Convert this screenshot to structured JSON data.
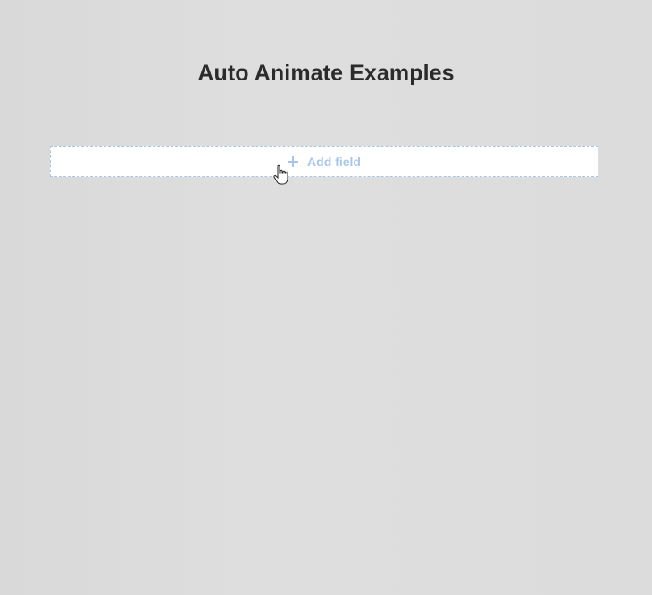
{
  "page": {
    "title": "Auto Animate Examples"
  },
  "add_field_button": {
    "label": "Add field",
    "icon": "plus-icon"
  },
  "cursor": {
    "icon": "hand-pointer-cursor-icon"
  },
  "colors": {
    "background": "#dcdcdc",
    "title": "#2b2b2b",
    "button_background": "#ffffff",
    "accent": "#a9c6ea"
  }
}
